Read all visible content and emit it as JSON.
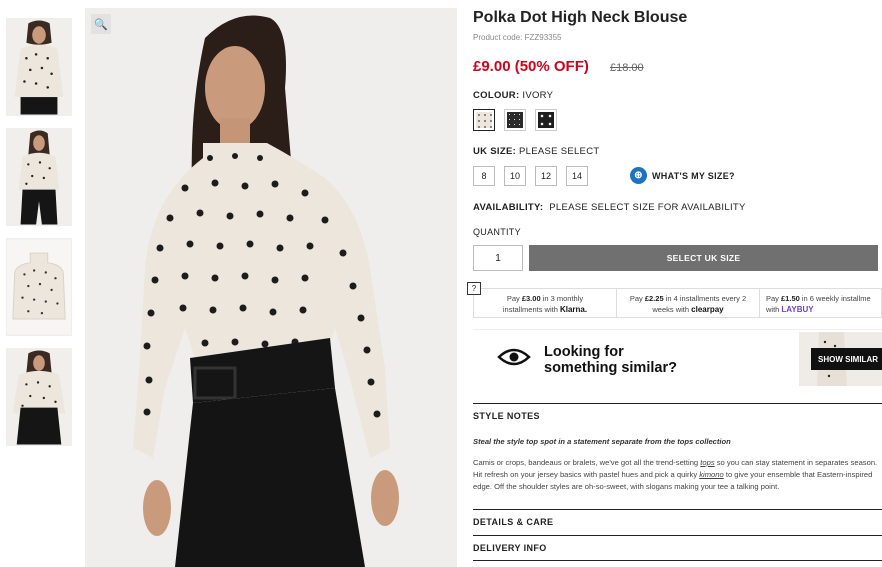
{
  "product": {
    "title": "Polka Dot High Neck Blouse",
    "code": "Product code: FZZ93355",
    "price": "£9.00 (50% OFF)",
    "was_price": "£18.00"
  },
  "colour": {
    "label": "COLOUR:",
    "value": "IVORY",
    "swatches": [
      {
        "name": "ivory",
        "color": "#ece6dd"
      },
      {
        "name": "black",
        "color": "#2a2a2a"
      },
      {
        "name": "black-white",
        "color": "#1e1e1e"
      }
    ]
  },
  "size": {
    "label": "UK SIZE:",
    "value": "PLEASE SELECT",
    "options": [
      "8",
      "10",
      "12",
      "14"
    ],
    "whats_my_size": "WHAT'S MY SIZE?"
  },
  "availability": {
    "label": "AVAILABILITY:",
    "value": "PLEASE SELECT SIZE FOR AVAILABILITY"
  },
  "quantity": {
    "label": "QUANTITY",
    "value": "1",
    "button": "SELECT UK SIZE"
  },
  "payments": {
    "help": "?",
    "klarna": {
      "pre": "Pay ",
      "amount": "£3.00",
      "mid": " in 3 monthly",
      "line2": "installments with ",
      "brand": "Klarna."
    },
    "clearpay": {
      "pre": "Pay ",
      "amount": "£2.25",
      "mid": " in 4 installments every 2",
      "line2": "weeks with ",
      "brand": "clearpay"
    },
    "laybuy": {
      "pre": "Pay ",
      "amount": "£1.50",
      "mid": " in 6 weekly installme",
      "line2": "with ",
      "brand": "LAYBUY"
    }
  },
  "similar": {
    "line1": "Looking for",
    "line2": "something similar?",
    "button": "SHOW SIMILAR"
  },
  "style_notes": {
    "title": "STYLE NOTES",
    "intro": "Steal the style top spot in a statement separate from the tops collection",
    "body_1": "Camis or crops, bandeaus or bralets, we've got all the trend-setting ",
    "body_tops": "tops",
    "body_2": " so you can stay statement in separates season. Hit refresh on your jersey basics with pastel hues and pick a quirky ",
    "body_kimono": "kimono",
    "body_3": " to give your ensemble that Eastern-inspired edge. Off the shoulder styles are oh-so-sweet, with slogans making your tee a talking point."
  },
  "details": {
    "title": "DETAILS & CARE"
  },
  "delivery": {
    "title": "DELIVERY INFO"
  },
  "zoom_icon": "magnifier-icon",
  "colors": {
    "sale": "#d0021b",
    "button": "#707070",
    "accent": "#1e73be"
  }
}
